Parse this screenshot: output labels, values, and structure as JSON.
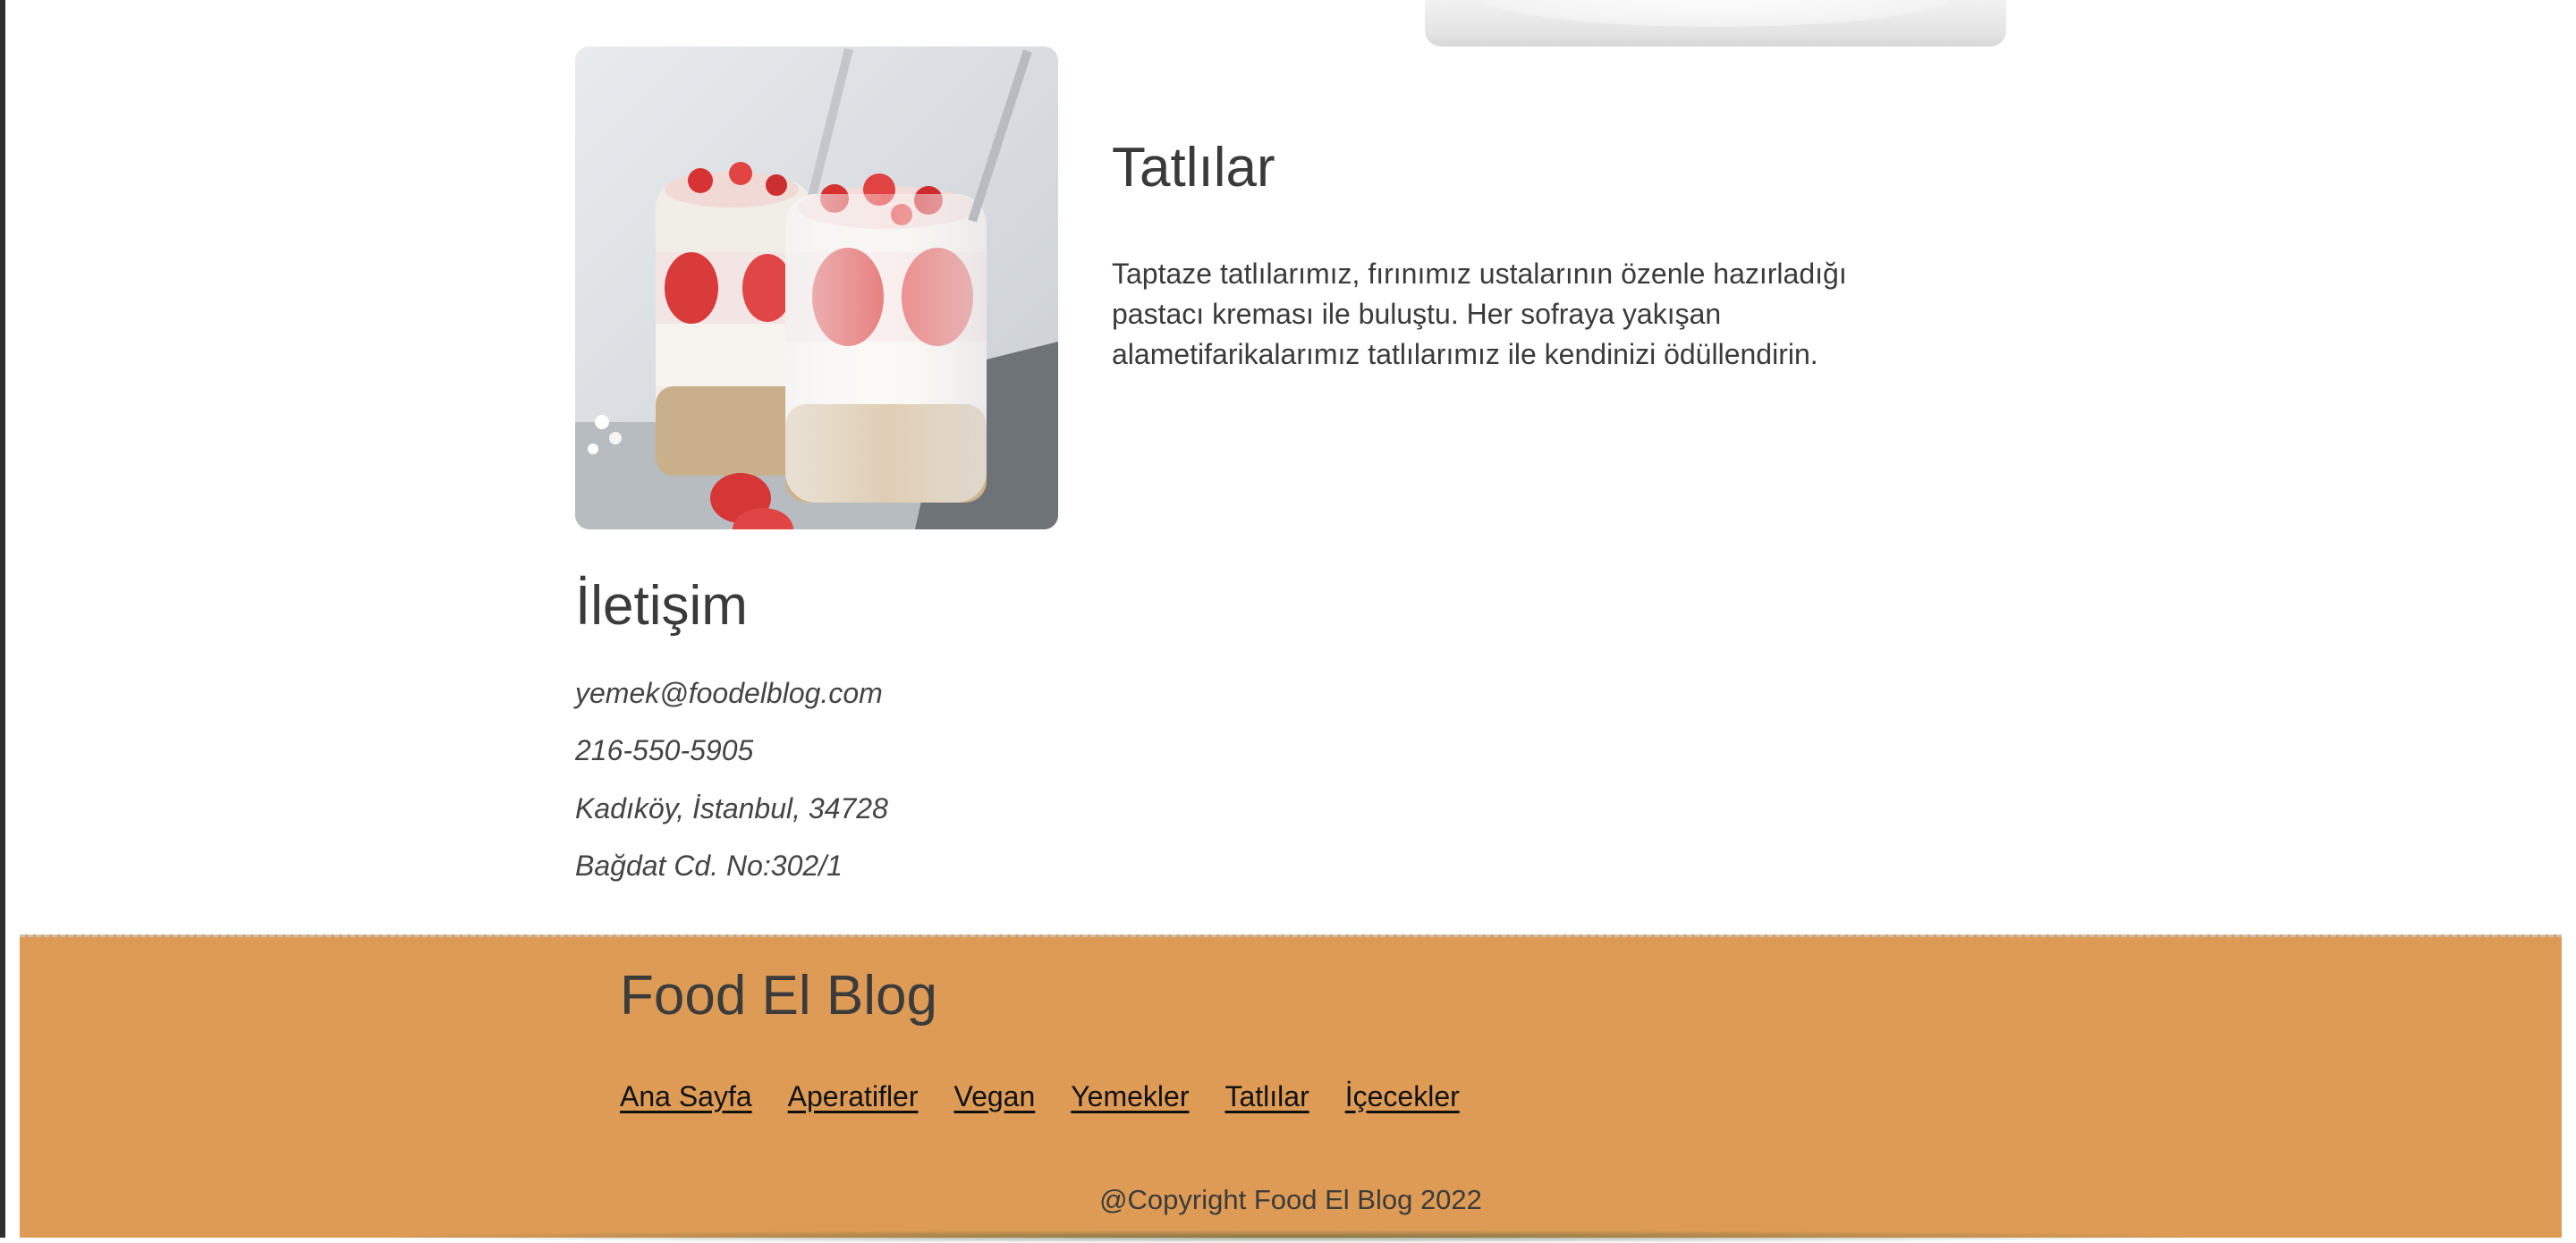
{
  "dessert_section": {
    "title": "Tatlılar",
    "description": "Taptaze tatlılarımız, fırınımız ustalarının özenle hazırladığı pastacı kreması ile buluştu. Her sofraya yakışan alametifarikalarımız tatlılarımız ile kendinizi ödüllendirin."
  },
  "contact": {
    "title": "İletişim",
    "email": "yemek@foodelblog.com",
    "phone": "216-550-5905",
    "city_line": "Kadıköy, İstanbul, 34728",
    "street_line": "Bağdat Cd. No:302/1"
  },
  "footer": {
    "brand": "Food El Blog",
    "nav": [
      "Ana Sayfa",
      "Aperatifler",
      "Vegan",
      "Yemekler",
      "Tatlılar",
      "İçecekler"
    ],
    "copyright": "@Copyright Food El Blog 2022",
    "background_color": "#dd9b55"
  },
  "images": {
    "top_partial": "food-photo",
    "dessert": "dessert-parfait-photo"
  }
}
